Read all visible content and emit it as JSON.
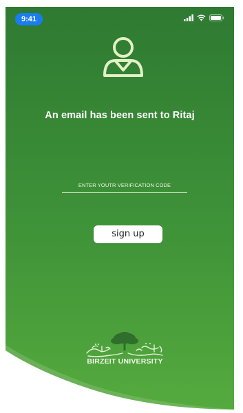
{
  "status_bar": {
    "time": "9:41",
    "icons": [
      "signal-icon",
      "wifi-icon",
      "battery-icon"
    ]
  },
  "header": {
    "icon": "user-icon",
    "title": "An email has been sent to Ritaj"
  },
  "form": {
    "code_placeholder": "ENTER YOUTR VERIFICATION CODE",
    "code_value": "",
    "signup_label": "sign up"
  },
  "footer": {
    "logo_text": "BIRZEIT UNIVERSITY"
  },
  "colors": {
    "green_top": "#2f7d33",
    "green_bottom": "#4ea53c",
    "accent_light": "#e3f1c6",
    "time_pill": "#1a7cf0"
  }
}
